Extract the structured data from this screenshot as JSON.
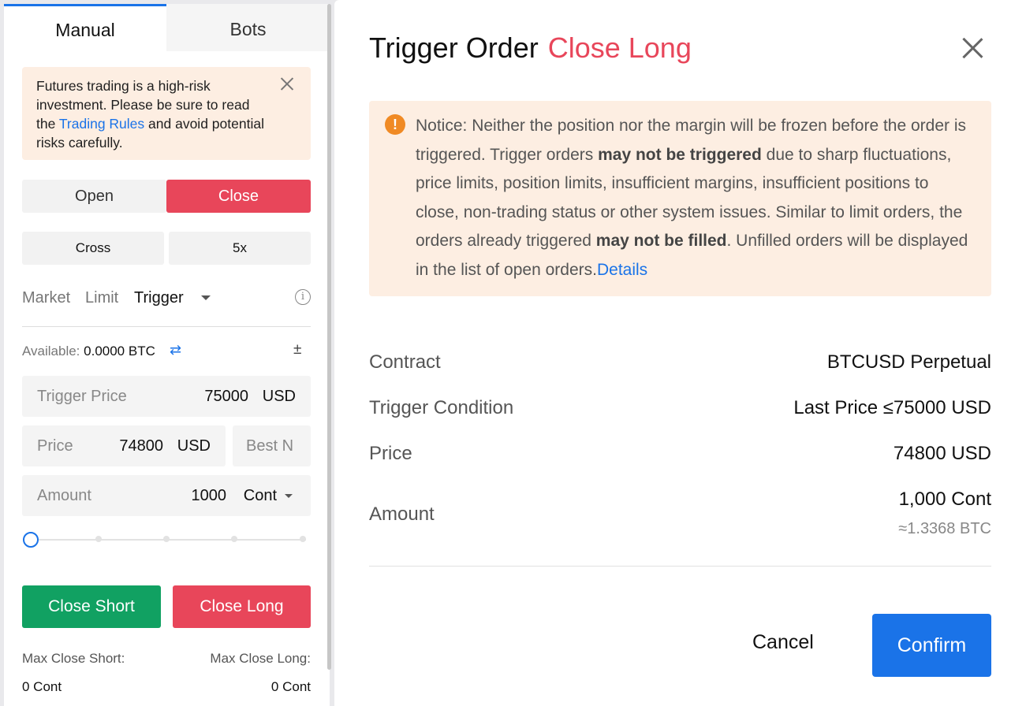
{
  "tabs": {
    "manual": "Manual",
    "bots": "Bots"
  },
  "risk_notice": {
    "text_before": "Futures trading is a high-risk investment. Please be sure to read the ",
    "link": "Trading Rules",
    "text_after": " and avoid potential risks carefully."
  },
  "position_side": {
    "open": "Open",
    "close": "Close"
  },
  "margin": {
    "mode": "Cross",
    "leverage": "5x"
  },
  "order_types": {
    "market": "Market",
    "limit": "Limit",
    "trigger": "Trigger"
  },
  "available": {
    "label": "Available:",
    "value": "0.0000 BTC"
  },
  "form": {
    "trigger_price": {
      "label": "Trigger Price",
      "value": "75000",
      "unit": "USD"
    },
    "price": {
      "label": "Price",
      "value": "74800",
      "unit": "USD"
    },
    "best_price": "Best N",
    "amount": {
      "label": "Amount",
      "value": "1000",
      "unit": "Cont"
    },
    "slider_level": 0
  },
  "actions": {
    "close_short": "Close Short",
    "close_long": "Close Long"
  },
  "max_close": {
    "short_label": "Max Close Short:",
    "short_value": "0 Cont",
    "long_label": "Max Close Long:",
    "long_value": "0 Cont"
  },
  "modal": {
    "title": "Trigger Order",
    "side": "Close Long",
    "notice": {
      "p1": "Notice: Neither the position nor the margin will be frozen before the order is triggered. Trigger orders ",
      "b1": "may not be triggered",
      "p2": " due to sharp fluctuations, price limits, position limits, insufficient margins, insufficient positions to close, non-trading status or other system issues. Similar to limit orders, the orders already triggered ",
      "b2": "may not be filled",
      "p3": ". Unfilled orders will be displayed in the list of open orders.",
      "link": "Details"
    },
    "rows": {
      "contract": {
        "label": "Contract",
        "value": "BTCUSD Perpetual"
      },
      "condition": {
        "label": "Trigger Condition",
        "value": "Last Price ≤75000 USD"
      },
      "price": {
        "label": "Price",
        "value": "74800 USD"
      },
      "amount": {
        "label": "Amount",
        "value": "1,000 Cont",
        "sub": "≈1.3368 BTC"
      }
    },
    "cancel": "Cancel",
    "confirm": "Confirm"
  },
  "colors": {
    "accent": "#1a73e8",
    "sell": "#e8465a",
    "buy": "#11a162",
    "notice_bg": "#fdeee2",
    "warn": "#f08a24"
  },
  "icons": [
    "close-icon",
    "info-icon",
    "swap-icon",
    "plus-minus-icon",
    "caret-down-icon",
    "warning-icon"
  ]
}
